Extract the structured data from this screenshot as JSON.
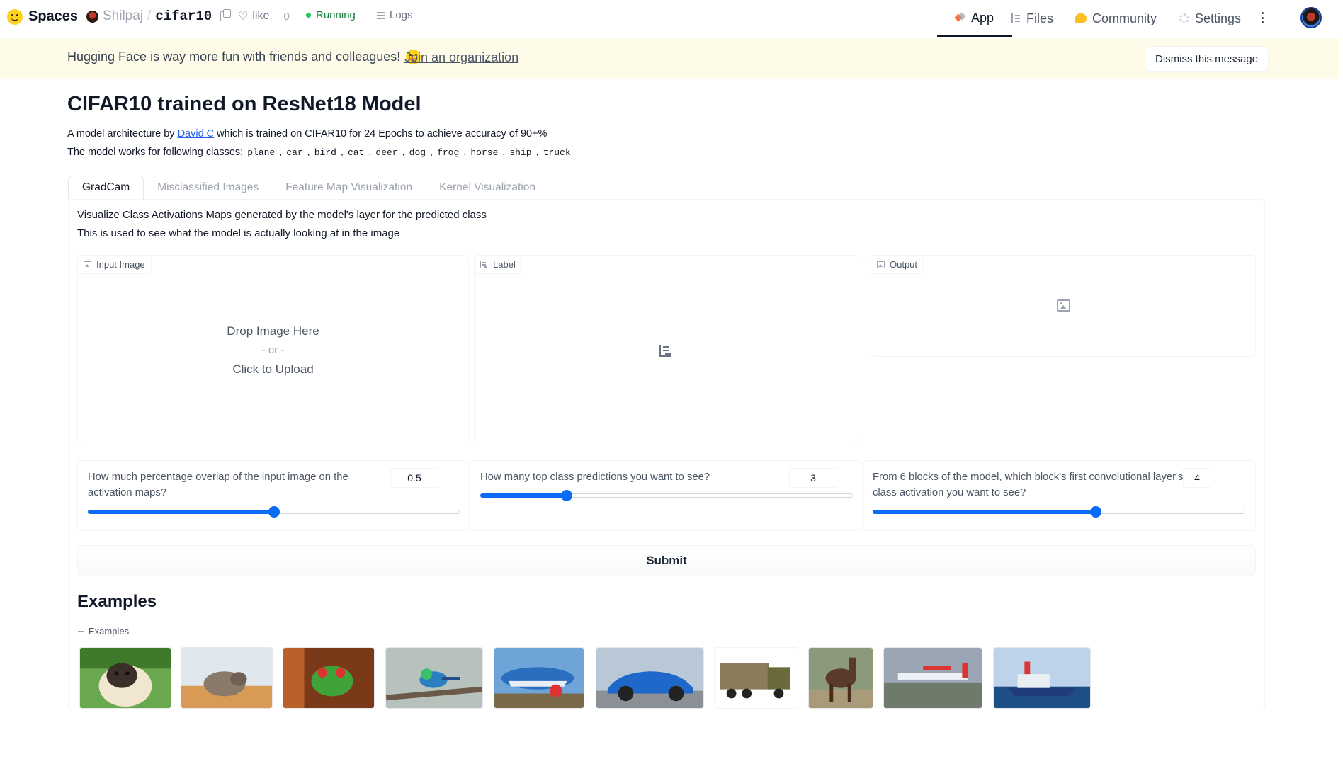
{
  "header": {
    "brand": "Spaces",
    "owner": "Shilpaj",
    "repo": "cifar10",
    "like_label": "like",
    "like_count": "0",
    "status": "Running",
    "logs": "Logs",
    "nav": {
      "app": "App",
      "files": "Files",
      "community": "Community",
      "settings": "Settings"
    }
  },
  "banner": {
    "text": "Hugging Face is way more fun with friends and colleagues!",
    "link": "Join an organization",
    "dismiss": "Dismiss this message"
  },
  "main": {
    "title": "CIFAR10 trained on ResNet18 Model",
    "desc_prefix": "A model architecture by",
    "author": "David C",
    "desc_suffix": "which is trained on CIFAR10 for 24 Epochs to achieve accuracy of 90+%",
    "classes_prefix": "The model works for following classes:",
    "classes": [
      "plane",
      "car",
      "bird",
      "cat",
      "deer",
      "dog",
      "frog",
      "horse",
      "ship",
      "truck"
    ],
    "tabs": [
      "GradCam",
      "Misclassified Images",
      "Feature Map Visualization",
      "Kernel Visualization"
    ],
    "active_tab": "GradCam",
    "panel_desc1": "Visualize Class Activations Maps generated by the model's layer for the predicted class",
    "panel_desc2": "This is used to see what the model is actually looking at in the image"
  },
  "input_image": {
    "label": "Input Image",
    "drop": "Drop Image Here",
    "or": "- or -",
    "click": "Click to Upload"
  },
  "label_block": {
    "label": "Label"
  },
  "output_block": {
    "label": "Output"
  },
  "sliders": [
    {
      "label_line1": "How much percentage overlap of the input image on the",
      "label_line2": "activation maps?",
      "value": "0.5",
      "fraction": 0.5
    },
    {
      "label_line1": "How many top class predictions you want to see?",
      "label_line2": "",
      "value": "3",
      "fraction": 0.23
    },
    {
      "label_line1": "From 6 blocks of the model, which block's first convolutional layer's",
      "label_line2": "class activation you want to see?",
      "value": "4",
      "fraction": 0.6
    }
  ],
  "submit": "Submit",
  "examples": {
    "title": "Examples",
    "label": "Examples",
    "items": [
      "dog",
      "cat",
      "frog",
      "bird",
      "plane",
      "car",
      "truck",
      "horse",
      "plane",
      "ship"
    ]
  },
  "colors": {
    "accent": "#0b6bf5",
    "banner_bg": "#fefbe8",
    "running": "#22c55e"
  }
}
